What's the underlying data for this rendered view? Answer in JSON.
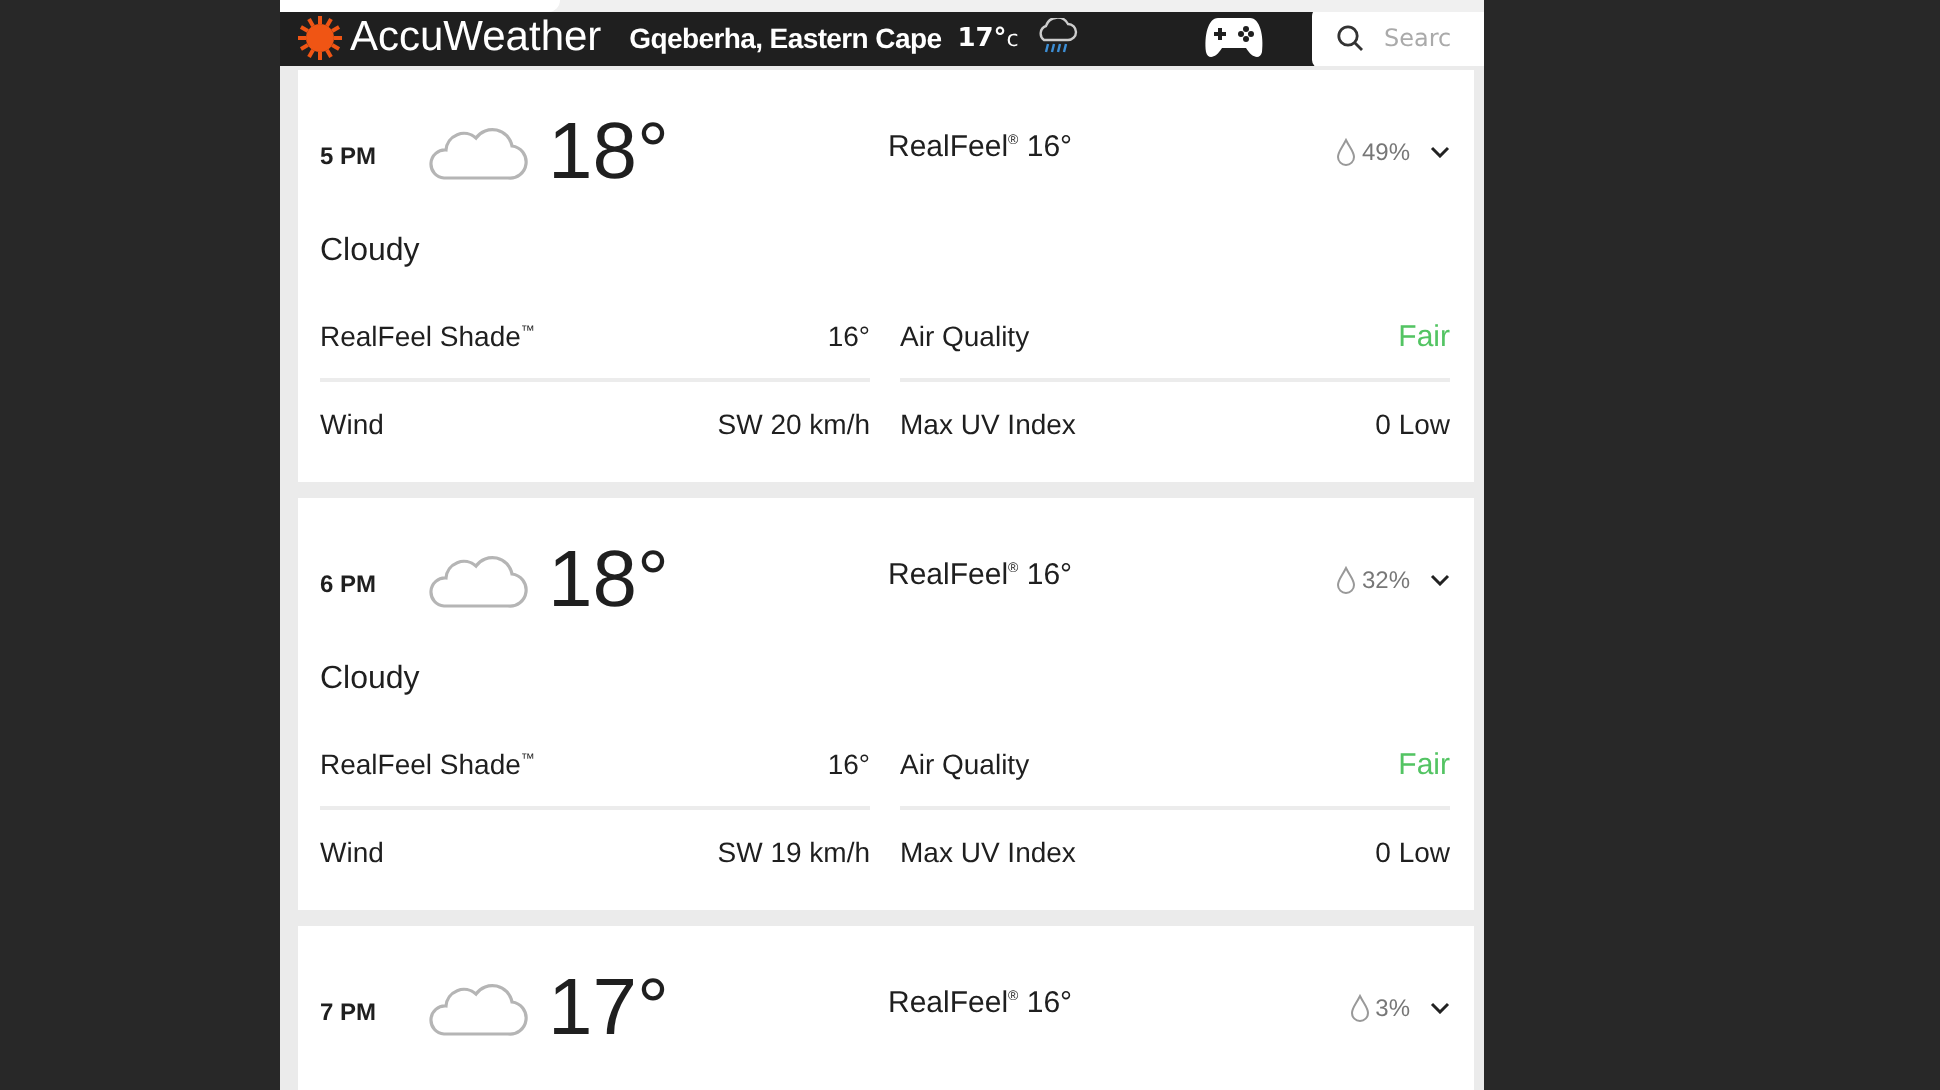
{
  "header": {
    "brand": "AccuWeather",
    "location": "Gqeberha, Eastern Cape",
    "current_temp": "17°",
    "temp_unit": "c",
    "search": {
      "placeholder": "Searc"
    }
  },
  "hours": [
    {
      "time": "5 PM",
      "temp": "18°",
      "realfeel": "RealFeel$^{®}$ 16°",
      "precip": "49%",
      "condition": "Cloudy",
      "details": [
        {
          "label": "RealFeel Shade$^{™}$",
          "value": "16°"
        },
        {
          "label": "Air Quality",
          "value": "Fair",
          "kind": "good"
        },
        {
          "label": "Wind",
          "value": "SW 20 km/h"
        },
        {
          "label": "Max UV Index",
          "value": "0 Low"
        }
      ]
    },
    {
      "time": "6 PM",
      "temp": "18°",
      "realfeel": "RealFeel$^{®}$ 16°",
      "precip": "32%",
      "condition": "Cloudy",
      "details": [
        {
          "label": "RealFeel Shade$^{™}$",
          "value": "16°"
        },
        {
          "label": "Air Quality",
          "value": "Fair",
          "kind": "good"
        },
        {
          "label": "Wind",
          "value": "SW 19 km/h"
        },
        {
          "label": "Max UV Index",
          "value": "0 Low"
        }
      ]
    },
    {
      "time": "7 PM",
      "temp": "17°",
      "realfeel": "RealFeel$^{®}$ 16°",
      "precip": "3%"
    }
  ]
}
